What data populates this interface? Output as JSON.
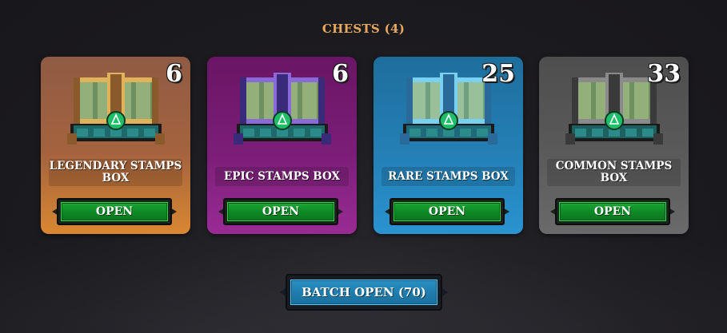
{
  "section": {
    "title": "CHESTS (4)"
  },
  "chests": [
    {
      "name": "LEGENDARY STAMPS BOX",
      "count": "6",
      "button_label": "OPEN",
      "rarity": "legendary",
      "colors": {
        "trim": "#e0b25a",
        "trim_dark": "#8a5a2a",
        "body": "#6e8f5e",
        "body_light": "#93b07a",
        "base": "#1e6a6a"
      }
    },
    {
      "name": "EPIC STAMPS BOX",
      "count": "6",
      "button_label": "OPEN",
      "rarity": "epic",
      "colors": {
        "trim": "#8a6ad8",
        "trim_dark": "#3a2a7a",
        "body": "#6e8f5e",
        "body_light": "#93b07a",
        "base": "#1e6a6a"
      }
    },
    {
      "name": "RARE STAMPS BOX",
      "count": "25",
      "button_label": "OPEN",
      "rarity": "rare",
      "colors": {
        "trim": "#7ad0f0",
        "trim_dark": "#2a6a9a",
        "body": "#6e9f7e",
        "body_light": "#98c09a",
        "base": "#1e6a7a"
      }
    },
    {
      "name": "COMMON STAMPS BOX",
      "count": "33",
      "button_label": "OPEN",
      "rarity": "common",
      "colors": {
        "trim": "#8a8a8a",
        "trim_dark": "#3a3a3a",
        "body": "#6e8f5e",
        "body_light": "#93b07a",
        "base": "#1e6060"
      }
    }
  ],
  "batch_button": {
    "label": "BATCH OPEN (70)"
  },
  "theme": {
    "title_color": "#e8a860",
    "open_button_color": "#11932b",
    "batch_button_color": "#1f7eb0",
    "gem_color": "#1fbf6a"
  }
}
